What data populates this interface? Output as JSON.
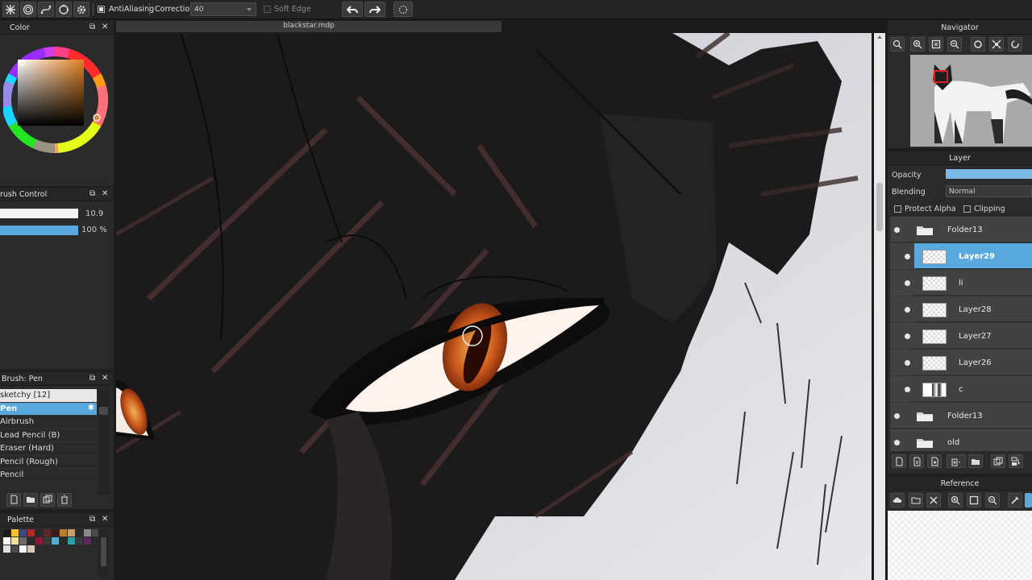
{
  "toolbar": {
    "antialiasing_label": "AntiAliasing",
    "correction_label": "Correction",
    "correction_value": "40",
    "soft_edge_label": "Soft Edge"
  },
  "panels": {
    "color_title": "Color",
    "brush_control_title": "rush Control",
    "brush_list_title": "Brush: Pen",
    "palette_title": "Palette",
    "navigator_title": "Navigator",
    "layer_title": "Layer",
    "reference_title": "Reference"
  },
  "brush_control": {
    "size_value": "10.9",
    "opacity_value": "100 %",
    "size_fraction": 0.97,
    "opacity_fraction": 0.97
  },
  "brushes": [
    {
      "label": "sketchy [12]",
      "state": "highlighted"
    },
    {
      "label": "Pen",
      "state": "selected"
    },
    {
      "label": "Airbrush",
      "state": "normal"
    },
    {
      "label": "Lead Pencil (B)",
      "state": "normal"
    },
    {
      "label": "Eraser (Hard)",
      "state": "normal"
    },
    {
      "label": "Pencil (Rough)",
      "state": "normal"
    },
    {
      "label": "Pencil",
      "state": "normal"
    }
  ],
  "palette_colors": [
    "#1a1a1a",
    "#f2c230",
    "#3a4a7a",
    "#b02a2a",
    "#2a2a2a",
    "#5a2a2a",
    "#3a1a1a",
    "#b8802a",
    "#c8a070",
    "#2a2a2a",
    "#8a8a8a",
    "#4a4a4a",
    "#dadada",
    "#ffffff",
    "#f0e0a0",
    "#6a6a6a",
    "#2a2a2a",
    "#8a1a3a",
    "#3a3a3a",
    "#5aaad0",
    "#2a2a2a",
    "#2aa0a0",
    "#3a3a3a",
    "#5a2a5a",
    "#2a2a2a",
    "#3a3a3a",
    "#e0e0e0",
    "#4a4a4a",
    "#f5f5f5",
    "#d8c8b8"
  ],
  "canvas": {
    "document_tab": "blackstar.mdp"
  },
  "layer_panel": {
    "opacity_label": "Opacity",
    "opacity_fraction": 1.0,
    "blending_label": "Blending",
    "blending_value": "Normal",
    "protect_alpha_label": "Protect Alpha",
    "clipping_label": "Clipping"
  },
  "layers": [
    {
      "name": "Folder13",
      "kind": "folder",
      "selected": false
    },
    {
      "name": "Layer29",
      "kind": "layer",
      "selected": true
    },
    {
      "name": "li",
      "kind": "layer",
      "selected": false
    },
    {
      "name": "Layer28",
      "kind": "layer",
      "selected": false
    },
    {
      "name": "Layer27",
      "kind": "layer",
      "selected": false
    },
    {
      "name": "Layer26",
      "kind": "layer",
      "selected": false
    },
    {
      "name": "c",
      "kind": "layer",
      "selected": false
    },
    {
      "name": "Folder13",
      "kind": "folder",
      "selected": false
    },
    {
      "name": "old",
      "kind": "folder",
      "selected": false
    }
  ],
  "colors": {
    "accent": "#5aa9de",
    "panel_bg": "#2b2b2b",
    "current_color": "#d98a3a"
  }
}
